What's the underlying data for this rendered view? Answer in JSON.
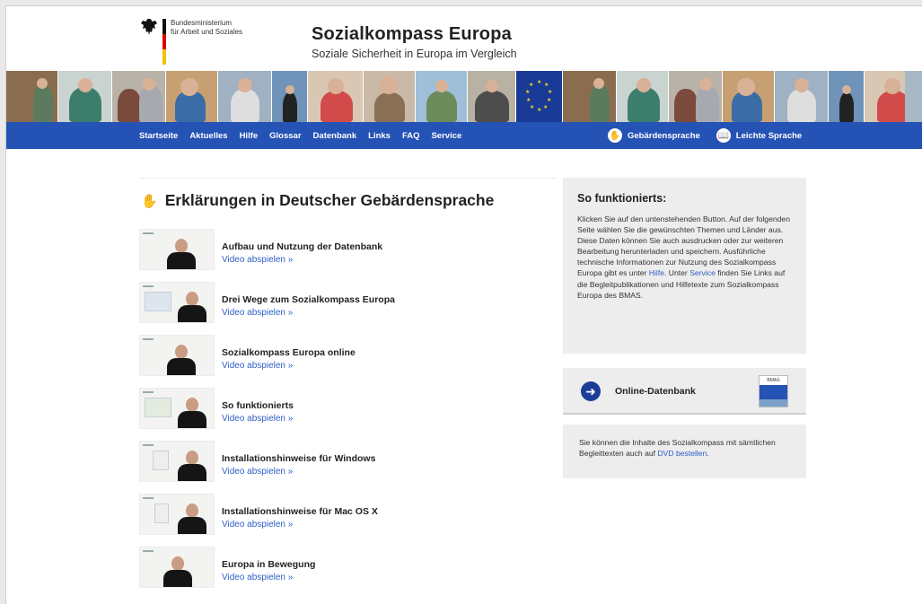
{
  "header": {
    "ministry_line1": "Bundesministerium",
    "ministry_line2": "für Arbeit und Soziales",
    "title": "Sozialkompass Europa",
    "subtitle": "Soziale Sicherheit in Europa im Vergleich"
  },
  "nav": {
    "items": [
      {
        "label": "Startseite"
      },
      {
        "label": "Aktuelles"
      },
      {
        "label": "Hilfe"
      },
      {
        "label": "Glossar"
      },
      {
        "label": "Datenbank"
      },
      {
        "label": "Links"
      },
      {
        "label": "FAQ"
      },
      {
        "label": "Service"
      }
    ],
    "right": [
      {
        "label": "Gebärdensprache",
        "icon": "hand-sign-icon"
      },
      {
        "label": "Leichte Sprache",
        "icon": "easy-language-icon"
      }
    ]
  },
  "main": {
    "heading": "Erklärungen in Deutscher Gebärdensprache",
    "videos": [
      {
        "title": "Aufbau und Nutzung der Datenbank",
        "link": "Video abspielen »"
      },
      {
        "title": "Drei Wege zum Sozialkompass Europa",
        "link": "Video abspielen »"
      },
      {
        "title": "Sozialkompass Europa online",
        "link": "Video abspielen »"
      },
      {
        "title": "So funktionierts",
        "link": "Video abspielen »"
      },
      {
        "title": "Installationshinweise für Windows",
        "link": "Video abspielen »"
      },
      {
        "title": "Installationshinweise für Mac OS X",
        "link": "Video abspielen »"
      },
      {
        "title": "Europa in Bewegung",
        "link": "Video abspielen »"
      }
    ]
  },
  "sidebar": {
    "how": {
      "title": "So funktionierts:",
      "text1": "Klicken Sie auf den untenstehenden Button. Auf der folgenden Seite wählen Sie die gewünschten Themen und Länder aus. Diese Daten können Sie auch ausdrucken oder zur weiteren Bearbeitung herunterladen und speichern. Ausführliche technische Informationen zur Nutzung des Sozialkompass Europa gibt es unter ",
      "link1": "Hilfe",
      "text2": ". Unter ",
      "link2": "Service",
      "text3": " finden Sie Links auf die Begleitpublikationen und Hilfetexte zum Sozialkompass Europa des BMAS."
    },
    "db_button": {
      "label": "Online-Datenbank",
      "dvd_label": "BMAS"
    },
    "dvd": {
      "text": "Sie können die Inhalte des Sozialkompass mit sämtlichen Begleittexten auch auf ",
      "link": "DVD bestellen",
      "after": "."
    }
  },
  "colors": {
    "nav_bg": "#2552b5",
    "link": "#2d5fc4",
    "box_bg": "#ededed"
  }
}
